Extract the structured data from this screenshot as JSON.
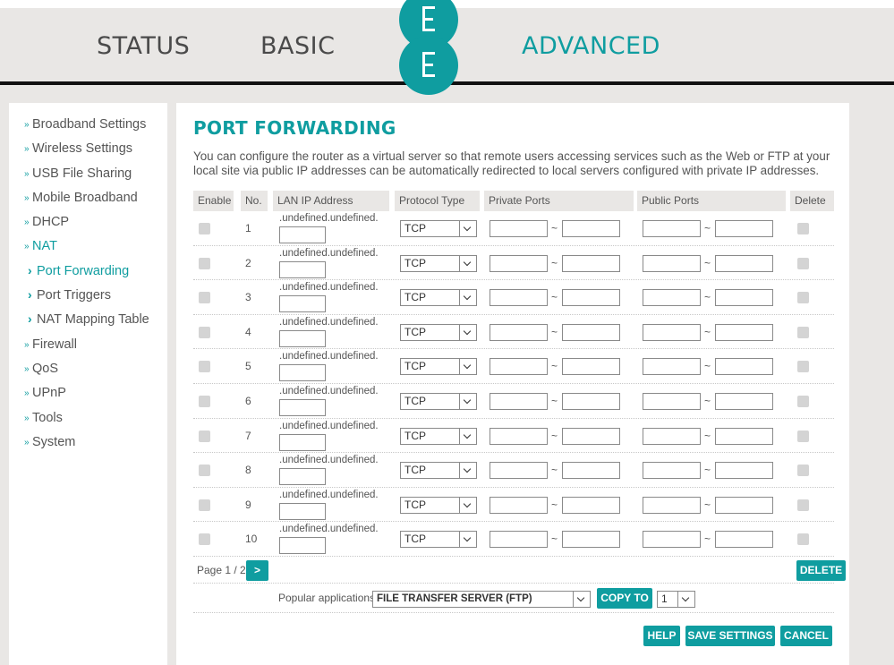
{
  "header": {
    "tabs": [
      {
        "label": "STATUS",
        "active": false
      },
      {
        "label": "BASIC",
        "active": false
      },
      {
        "label": "ADVANCED",
        "active": true
      }
    ],
    "logo": "EE"
  },
  "sidebar": {
    "items": [
      {
        "label": "Broadband Settings",
        "sub": false,
        "active": false
      },
      {
        "label": "Wireless Settings",
        "sub": false,
        "active": false
      },
      {
        "label": "USB File Sharing",
        "sub": false,
        "active": false
      },
      {
        "label": "Mobile Broadband",
        "sub": false,
        "active": false
      },
      {
        "label": "DHCP",
        "sub": false,
        "active": false
      },
      {
        "label": "NAT",
        "sub": false,
        "active": true
      },
      {
        "label": "Port Forwarding",
        "sub": true,
        "active": true
      },
      {
        "label": "Port Triggers",
        "sub": true,
        "active": false
      },
      {
        "label": "NAT Mapping Table",
        "sub": true,
        "active": false
      },
      {
        "label": "Firewall",
        "sub": false,
        "active": false
      },
      {
        "label": "QoS",
        "sub": false,
        "active": false
      },
      {
        "label": "UPnP",
        "sub": false,
        "active": false
      },
      {
        "label": "Tools",
        "sub": false,
        "active": false
      },
      {
        "label": "System",
        "sub": false,
        "active": false
      }
    ]
  },
  "main": {
    "title": "PORT FORWARDING",
    "description": "You can configure the router as a virtual server so that remote users accessing services such as the Web or FTP at your local site via public IP addresses can be automatically redirected to local servers configured with private IP addresses.",
    "columns": {
      "enable": "Enable",
      "no": "No.",
      "lan_ip": "LAN IP Address",
      "protocol": "Protocol Type",
      "private_ports": "Private Ports",
      "public_ports": "Public Ports",
      "delete": "Delete"
    },
    "rows": [
      {
        "no": "1",
        "ip_prefix": ".undefined.undefined.",
        "protocol": "TCP"
      },
      {
        "no": "2",
        "ip_prefix": ".undefined.undefined.",
        "protocol": "TCP"
      },
      {
        "no": "3",
        "ip_prefix": ".undefined.undefined.",
        "protocol": "TCP"
      },
      {
        "no": "4",
        "ip_prefix": ".undefined.undefined.",
        "protocol": "TCP"
      },
      {
        "no": "5",
        "ip_prefix": ".undefined.undefined.",
        "protocol": "TCP"
      },
      {
        "no": "6",
        "ip_prefix": ".undefined.undefined.",
        "protocol": "TCP"
      },
      {
        "no": "7",
        "ip_prefix": ".undefined.undefined.",
        "protocol": "TCP"
      },
      {
        "no": "8",
        "ip_prefix": ".undefined.undefined.",
        "protocol": "TCP"
      },
      {
        "no": "9",
        "ip_prefix": ".undefined.undefined.",
        "protocol": "TCP"
      },
      {
        "no": "10",
        "ip_prefix": ".undefined.undefined.",
        "protocol": "TCP"
      }
    ],
    "port_separator": "~",
    "pager_text": "Page 1 / 2",
    "next_label": ">",
    "delete_label": "DELETE",
    "popular_label": "Popular applications",
    "popular_value": "FILE TRANSFER SERVER (FTP)",
    "copy_to_label": "COPY TO",
    "copy_to_value": "1",
    "help_label": "HELP",
    "save_label": "SAVE SETTINGS",
    "cancel_label": "CANCEL"
  },
  "colors": {
    "accent": "#0f9da0",
    "header_bg": "#e9e7e5"
  }
}
